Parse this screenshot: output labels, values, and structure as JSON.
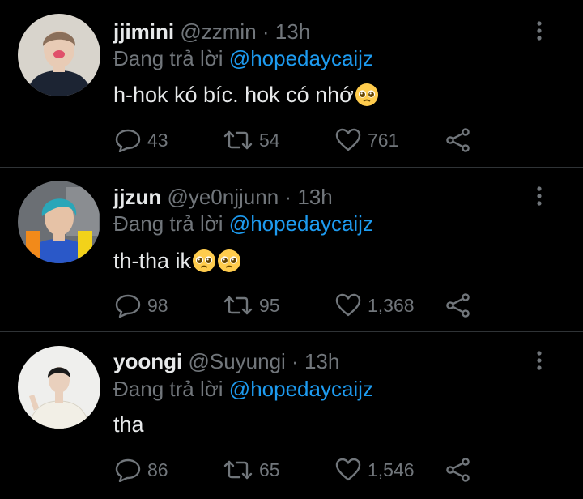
{
  "tweets": [
    {
      "name": "jjimini",
      "handle": "@zzmin",
      "separator": "·",
      "time": "13h",
      "reply_prefix": "Đang trả lời",
      "reply_to": "@hopedaycaijz",
      "text": "h-hok kó bíc. hok có nhớ",
      "emoji_count": 1,
      "emoji": "pleading-face",
      "replies": "43",
      "retweets": "54",
      "likes": "761",
      "avatar_colors": {
        "bg": "#d8d4cc",
        "hair": "#8a6f5a",
        "skin": "#e8cbb5",
        "shirt": "#1c2433"
      }
    },
    {
      "name": "jjzun",
      "handle": "@ye0njjunn",
      "separator": "·",
      "time": "13h",
      "reply_prefix": "Đang trả lời",
      "reply_to": "@hopedaycaijz",
      "text": "th-tha ik",
      "emoji_count": 2,
      "emoji": "pleading-face",
      "replies": "98",
      "retweets": "95",
      "likes": "1,368",
      "avatar_colors": {
        "bg": "#6b6f74",
        "hair": "#2aa6b8",
        "skin": "#e6c2a6",
        "shirt": "#f28a1a"
      }
    },
    {
      "name": "yoongi",
      "handle": "@Suyungi",
      "separator": "·",
      "time": "13h",
      "reply_prefix": "Đang trả lời",
      "reply_to": "@hopedaycaijz",
      "text": "tha",
      "emoji_count": 0,
      "emoji": "",
      "replies": "86",
      "retweets": "65",
      "likes": "1,546",
      "avatar_colors": {
        "bg": "#efefed",
        "hair": "#1a1a1a",
        "skin": "#e9d0bd",
        "shirt": "#f2efe6"
      }
    }
  ],
  "theme": {
    "background": "#000000",
    "text": "#e7e9ea",
    "muted": "#71767b",
    "link": "#1d9bf0",
    "divider": "#2f3336"
  }
}
